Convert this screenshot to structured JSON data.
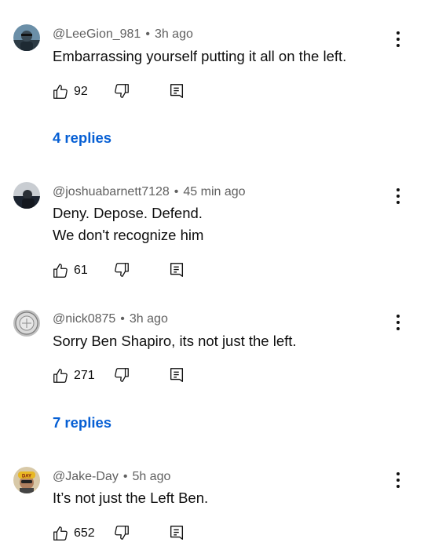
{
  "comments": [
    {
      "handle": "@LeeGion_981",
      "time": "3h ago",
      "lines": [
        "Embarrassing yourself putting it all on the left."
      ],
      "likes": "92",
      "replies": "4 replies"
    },
    {
      "handle": "@joshuabarnett7128",
      "time": "45 min ago",
      "lines": [
        "Deny. Depose. Defend.",
        "We don't recognize him"
      ],
      "likes": "61"
    },
    {
      "handle": "@nick0875",
      "time": "3h ago",
      "lines": [
        "Sorry Ben Shapiro, its not just the left."
      ],
      "likes": "271",
      "replies": "7 replies"
    },
    {
      "handle": "@Jake-Day",
      "time": "5h ago",
      "lines": [
        "It’s not just the Left Ben."
      ],
      "likes": "652",
      "avatar_text": "DAY"
    }
  ],
  "separator": "•",
  "colors": {
    "link": "#065fd4",
    "meta": "#606060",
    "text": "#0f0f0f"
  },
  "icons": {
    "like": "thumbs-up-icon",
    "dislike": "thumbs-down-icon",
    "reply": "reply-comment-icon",
    "menu": "more-vertical-icon"
  }
}
